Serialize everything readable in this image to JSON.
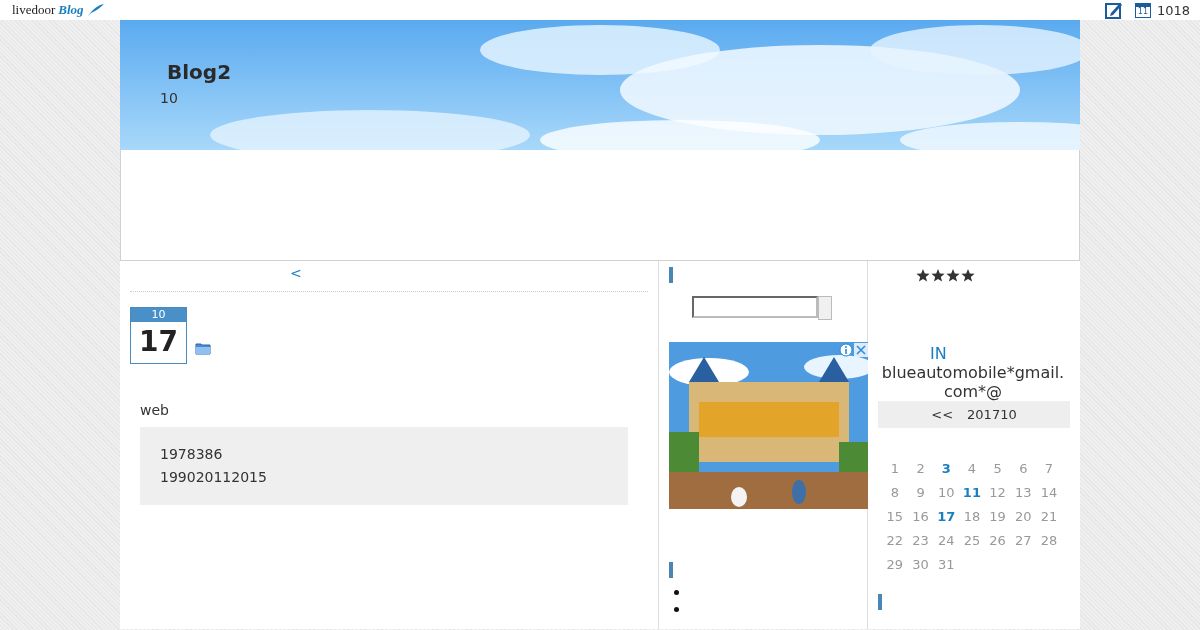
{
  "topbar": {
    "logo_word": "livedoor",
    "logo_blog": "Blog",
    "calendar_icon_day": "11",
    "count": "1018"
  },
  "header": {
    "title": "Blog2",
    "subtitle": "10"
  },
  "main": {
    "nav_link": "<",
    "post": {
      "month": "10",
      "day": "17",
      "category": "web",
      "quote_lines": [
        "1978386",
        "199020112015"
      ]
    }
  },
  "right": {
    "stars": 4,
    "in_link": "IN",
    "email": "blueautomobile*gmail.com*@",
    "calendar": {
      "prev": "<<",
      "month": "201710",
      "days": [
        {
          "label": "1",
          "linked": false
        },
        {
          "label": "2",
          "linked": false
        },
        {
          "label": "3",
          "linked": true
        },
        {
          "label": "4",
          "linked": false
        },
        {
          "label": "5",
          "linked": false
        },
        {
          "label": "6",
          "linked": false
        },
        {
          "label": "7",
          "linked": false
        },
        {
          "label": "8",
          "linked": false
        },
        {
          "label": "9",
          "linked": false
        },
        {
          "label": "10",
          "linked": false
        },
        {
          "label": "11",
          "linked": true
        },
        {
          "label": "12",
          "linked": false
        },
        {
          "label": "13",
          "linked": false
        },
        {
          "label": "14",
          "linked": false
        },
        {
          "label": "15",
          "linked": false
        },
        {
          "label": "16",
          "linked": false
        },
        {
          "label": "17",
          "linked": true
        },
        {
          "label": "18",
          "linked": false
        },
        {
          "label": "19",
          "linked": false
        },
        {
          "label": "20",
          "linked": false
        },
        {
          "label": "21",
          "linked": false
        },
        {
          "label": "22",
          "linked": false
        },
        {
          "label": "23",
          "linked": false
        },
        {
          "label": "24",
          "linked": false
        },
        {
          "label": "25",
          "linked": false
        },
        {
          "label": "26",
          "linked": false
        },
        {
          "label": "27",
          "linked": false
        },
        {
          "label": "28",
          "linked": false
        },
        {
          "label": "29",
          "linked": false
        },
        {
          "label": "30",
          "linked": false
        },
        {
          "label": "31",
          "linked": false
        }
      ]
    }
  }
}
